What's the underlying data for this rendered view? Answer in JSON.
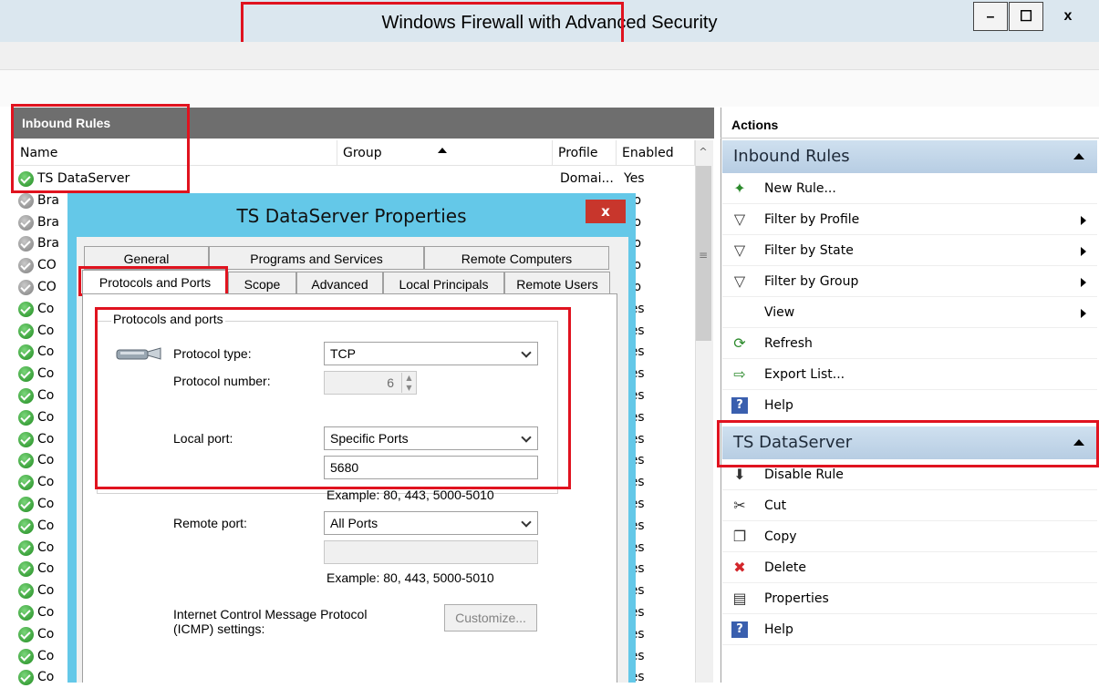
{
  "window": {
    "title": "Windows Firewall with Advanced Security",
    "minimize": "–",
    "maximize": "☐",
    "close": "x"
  },
  "left": {
    "header": "Inbound Rules",
    "columns": {
      "name": "Name",
      "group": "Group",
      "profile": "Profile",
      "enabled": "Enabled"
    },
    "rows": [
      {
        "name": "TS DataServer",
        "profile": "Domai...",
        "enabled": "Yes",
        "status": "enabled"
      },
      {
        "name": "Bra",
        "profile": "",
        "enabled": "No",
        "status": "disabled"
      },
      {
        "name": "Bra",
        "profile": "",
        "enabled": "No",
        "status": "disabled"
      },
      {
        "name": "Bra",
        "profile": "",
        "enabled": "No",
        "status": "disabled"
      },
      {
        "name": "CO",
        "profile": "",
        "enabled": "No",
        "status": "disabled"
      },
      {
        "name": "CO",
        "profile": "",
        "enabled": "No",
        "status": "disabled"
      },
      {
        "name": "Co",
        "profile": "",
        "enabled": "Yes",
        "status": "enabled"
      },
      {
        "name": "Co",
        "profile": "",
        "enabled": "Yes",
        "status": "enabled"
      },
      {
        "name": "Co",
        "profile": "",
        "enabled": "Yes",
        "status": "enabled"
      },
      {
        "name": "Co",
        "profile": "",
        "enabled": "Yes",
        "status": "enabled"
      },
      {
        "name": "Co",
        "profile": "",
        "enabled": "Yes",
        "status": "enabled"
      },
      {
        "name": "Co",
        "profile": "",
        "enabled": "Yes",
        "status": "enabled"
      },
      {
        "name": "Co",
        "profile": "",
        "enabled": "Yes",
        "status": "enabled"
      },
      {
        "name": "Co",
        "profile": "",
        "enabled": "Yes",
        "status": "enabled"
      },
      {
        "name": "Co",
        "profile": "",
        "enabled": "Yes",
        "status": "enabled"
      },
      {
        "name": "Co",
        "profile": "",
        "enabled": "Yes",
        "status": "enabled"
      },
      {
        "name": "Co",
        "profile": "",
        "enabled": "Yes",
        "status": "enabled"
      },
      {
        "name": "Co",
        "profile": "",
        "enabled": "Yes",
        "status": "enabled"
      },
      {
        "name": "Co",
        "profile": "",
        "enabled": "Yes",
        "status": "enabled"
      },
      {
        "name": "Co",
        "profile": "",
        "enabled": "Yes",
        "status": "enabled"
      },
      {
        "name": "Co",
        "profile": "",
        "enabled": "Yes",
        "status": "enabled"
      },
      {
        "name": "Co",
        "profile": "",
        "enabled": "Yes",
        "status": "enabled"
      },
      {
        "name": "Co",
        "profile": "",
        "enabled": "Yes",
        "status": "enabled"
      },
      {
        "name": "Co",
        "profile": "",
        "enabled": "Yes",
        "status": "enabled"
      }
    ]
  },
  "actions": {
    "header": "Actions",
    "section1": {
      "title": "Inbound Rules",
      "items": [
        {
          "label": "New Rule...",
          "icon": "new-rule-icon",
          "glyph": "✦",
          "arrow": false
        },
        {
          "label": "Filter by Profile",
          "icon": "filter-icon",
          "glyph": "▽",
          "arrow": true
        },
        {
          "label": "Filter by State",
          "icon": "filter-icon",
          "glyph": "▽",
          "arrow": true
        },
        {
          "label": "Filter by Group",
          "icon": "filter-icon",
          "glyph": "▽",
          "arrow": true
        },
        {
          "label": "View",
          "icon": "",
          "glyph": "",
          "arrow": true
        },
        {
          "label": "Refresh",
          "icon": "refresh-icon",
          "glyph": "⟳",
          "arrow": false
        },
        {
          "label": "Export List...",
          "icon": "export-icon",
          "glyph": "⇨",
          "arrow": false
        },
        {
          "label": "Help",
          "icon": "help-icon",
          "glyph": "?",
          "arrow": false
        }
      ]
    },
    "section2": {
      "title": "TS DataServer",
      "items": [
        {
          "label": "Disable Rule",
          "icon": "disable-icon",
          "glyph": "⬇"
        },
        {
          "label": "Cut",
          "icon": "scissors-icon",
          "glyph": "✂"
        },
        {
          "label": "Copy",
          "icon": "copy-icon",
          "glyph": "❐"
        },
        {
          "label": "Delete",
          "icon": "delete-icon",
          "glyph": "✖"
        },
        {
          "label": "Properties",
          "icon": "properties-icon",
          "glyph": "▤"
        },
        {
          "label": "Help",
          "icon": "help-icon",
          "glyph": "?"
        }
      ]
    }
  },
  "dialog": {
    "title": "TS DataServer Properties",
    "close": "x",
    "tabs_row1": [
      "General",
      "Programs and Services",
      "Remote Computers"
    ],
    "tabs_row2": [
      "Protocols and Ports",
      "Scope",
      "Advanced",
      "Local Principals",
      "Remote Users"
    ],
    "group_title": "Protocols and ports",
    "protocol_type_label": "Protocol type:",
    "protocol_type_value": "TCP",
    "protocol_number_label": "Protocol number:",
    "protocol_number_value": "6",
    "local_port_label": "Local port:",
    "local_port_value": "Specific Ports",
    "local_port_text": "5680",
    "local_example": "Example: 80, 443, 5000-5010",
    "remote_port_label": "Remote port:",
    "remote_port_value": "All Ports",
    "remote_port_text": "",
    "remote_example": "Example: 80, 443, 5000-5010",
    "icmp_label_line1": "Internet Control Message Protocol",
    "icmp_label_line2": "(ICMP) settings:",
    "customize": "Customize..."
  },
  "colors": {
    "highlight": "#e0131f",
    "dialog_frame": "#64c8e8",
    "section_header": "#c3d7ea"
  }
}
